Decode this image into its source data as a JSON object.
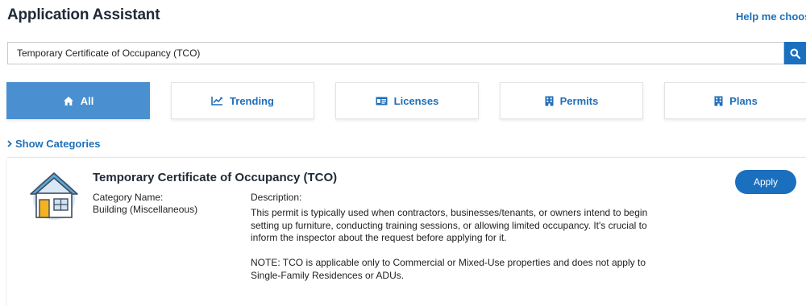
{
  "header": {
    "title": "Application Assistant",
    "help_link": "Help me choose"
  },
  "search": {
    "value": "Temporary Certificate of Occupancy (TCO)",
    "icon": "search-icon"
  },
  "tabs": [
    {
      "label": "All",
      "icon": "home-icon",
      "active": true
    },
    {
      "label": "Trending",
      "icon": "trending-chart-icon",
      "active": false
    },
    {
      "label": "Licenses",
      "icon": "id-card-icon",
      "active": false
    },
    {
      "label": "Permits",
      "icon": "building-icon",
      "active": false
    },
    {
      "label": "Plans",
      "icon": "building-icon",
      "active": false
    }
  ],
  "show_categories": "Show Categories",
  "result": {
    "title": "Temporary Certificate of Occupancy (TCO)",
    "category_label": "Category Name:",
    "category_value": "Building (Miscellaneous)",
    "description_label": "Description:",
    "description_p1": "This permit is typically used when contractors, businesses/tenants, or owners intend to begin setting up furniture, conducting training sessions, or allowing limited occupancy. It's crucial to inform the inspector about the request before applying for it.",
    "description_p2": "NOTE: TCO is applicable only to Commercial or Mixed-Use properties and does not apply to Single-Family Residences or ADUs.",
    "apply_label": "Apply",
    "icon": "house-icon"
  },
  "colors": {
    "accent": "#1a6fbf",
    "active_tab": "#4a8fd0",
    "link": "#1f6fb8"
  }
}
